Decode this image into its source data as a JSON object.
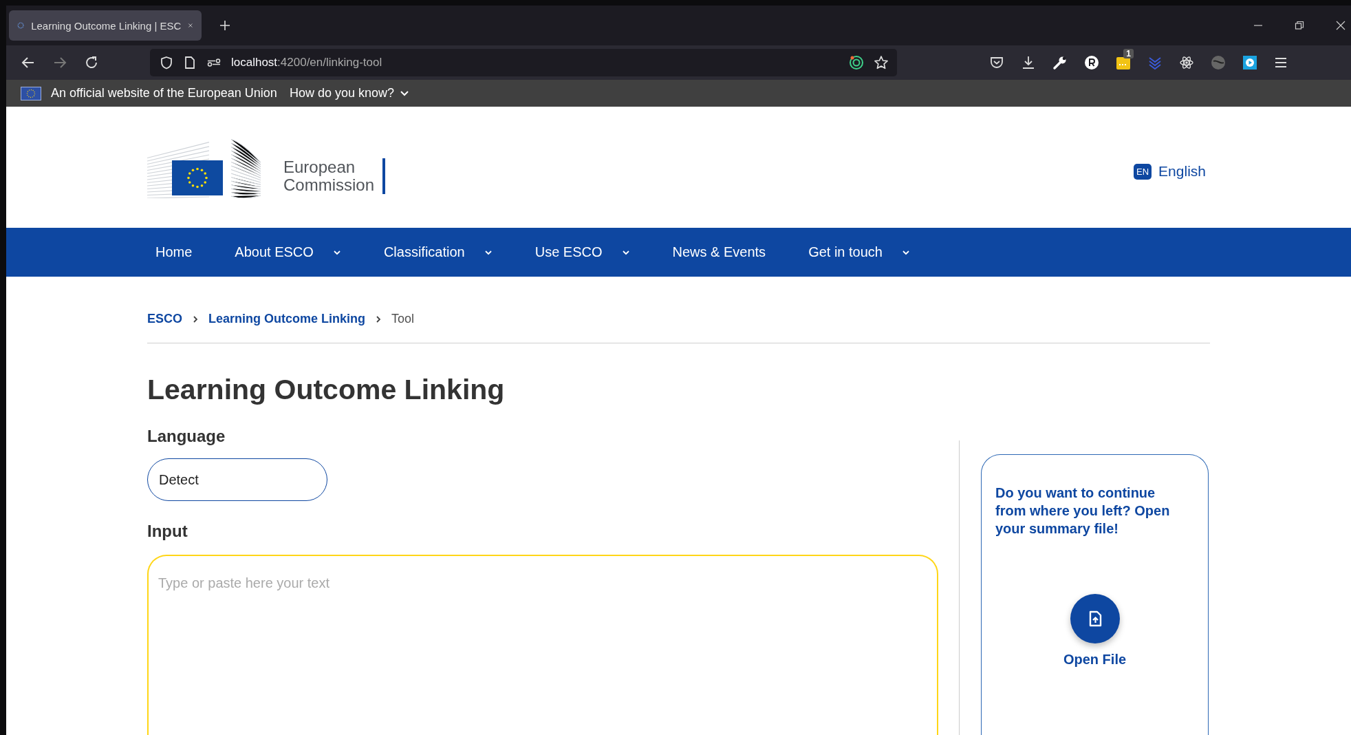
{
  "browser": {
    "tabs": [
      {
        "title": "Learning Outcome Linking | ESC",
        "selected": true
      }
    ],
    "address": {
      "host": "localhost",
      "path": ":4200/en/linking-tool"
    },
    "extension_badge": "1"
  },
  "eu_banner": {
    "text": "An official website of the European Union",
    "link": "How do you know?"
  },
  "header": {
    "logo_lines": [
      "European",
      "Commission"
    ],
    "language": {
      "code": "EN",
      "label": "English"
    }
  },
  "nav": [
    {
      "label": "Home",
      "dropdown": false
    },
    {
      "label": "About ESCO",
      "dropdown": true
    },
    {
      "label": "Classification",
      "dropdown": true
    },
    {
      "label": "Use ESCO",
      "dropdown": true
    },
    {
      "label": "News & Events",
      "dropdown": false
    },
    {
      "label": "Get in touch",
      "dropdown": true
    }
  ],
  "breadcrumb": [
    {
      "label": "ESCO",
      "kind": "link"
    },
    {
      "label": "Learning Outcome Linking",
      "kind": "link"
    },
    {
      "label": "Tool",
      "kind": "current"
    }
  ],
  "title": "Learning Outcome Linking",
  "language_field": {
    "label": "Language",
    "value": "Detect"
  },
  "input_field": {
    "label": "Input",
    "placeholder": "Type or paste here your text"
  },
  "side_card": {
    "text": "Do you want to continue from where you left? Open your summary file!",
    "button": "Open File"
  }
}
